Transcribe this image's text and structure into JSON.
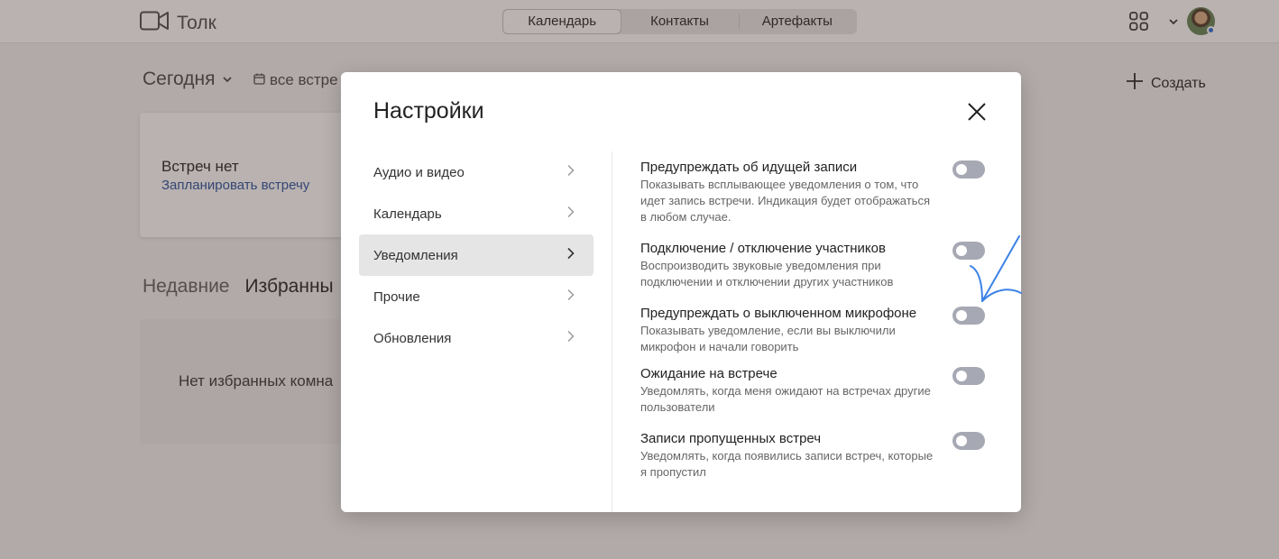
{
  "app": {
    "name": "Толк",
    "tabs": [
      "Календарь",
      "Контакты",
      "Артефакты"
    ],
    "active_tab": 0
  },
  "home": {
    "today_label": "Сегодня",
    "all_meetings_label": "все встре",
    "create_label": "Создать",
    "no_meetings": "Встреч нет",
    "schedule_link": "Запланировать встречу",
    "recent_tabs": [
      "Недавние",
      "Избранны"
    ],
    "no_favorites": "Нет избранных комна"
  },
  "modal": {
    "title": "Настройки",
    "menu": [
      {
        "label": "Аудио и видео",
        "active": false
      },
      {
        "label": "Календарь",
        "active": false
      },
      {
        "label": "Уведомления",
        "active": true
      },
      {
        "label": "Прочие",
        "active": false
      },
      {
        "label": "Обновления",
        "active": false
      }
    ],
    "settings": [
      {
        "title": "Предупреждать об идущей записи",
        "desc": "Показывать всплывающее уведомления о том, что идет запись встречи. Индикация будет отображаться в любом случае.",
        "enabled": false
      },
      {
        "title": "Подключение / отключение участников",
        "desc": "Воспроизводить звуковые уведомления при подключении и отключении других участников",
        "enabled": false
      },
      {
        "title": "Предупреждать о выключенном микрофоне",
        "desc": "Показывать уведомление, если вы выключили микрофон и начали говорить",
        "enabled": false
      },
      {
        "title": "Ожидание на встрече",
        "desc": "Уведомлять, когда меня ожидают на встречах другие пользователи",
        "enabled": false
      },
      {
        "title": "Записи пропущенных встреч",
        "desc": "Уведомлять, когда появились записи встреч, которые я пропустил",
        "enabled": false
      }
    ]
  },
  "colors": {
    "toggle_off": "#a6a9b3",
    "annotation_arrow": "#3b82e6",
    "link": "#3a5fa8"
  }
}
